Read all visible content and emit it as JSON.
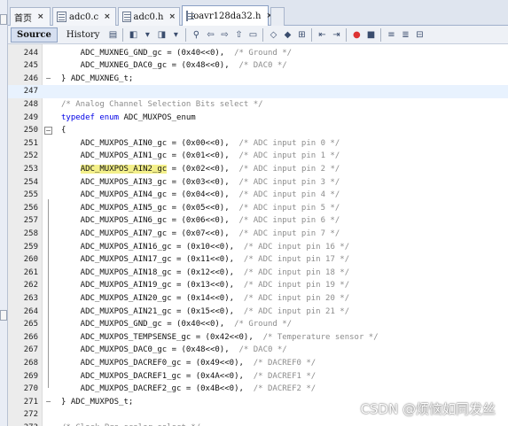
{
  "tabs": [
    {
      "label": "首页",
      "icon": "home-icon",
      "active": false
    },
    {
      "label": "adc0.c",
      "icon": "file-icon",
      "active": false
    },
    {
      "label": "adc0.h",
      "icon": "file-icon",
      "active": false
    },
    {
      "label": "ioavr128da32.h",
      "icon": "file-icon",
      "active": true
    }
  ],
  "toolbar": {
    "source_label": "Source",
    "history_label": "History"
  },
  "colors": {
    "keyword": "#0000e6",
    "comment": "#8c8c8c",
    "highlight": "#f4f08a",
    "current_line": "#e8f2fe"
  },
  "editor": {
    "lines": [
      {
        "num": "244",
        "code": "    ADC_MUXNEG_GND_gc = (0x40<<0),  ",
        "comment": "/* Ground */"
      },
      {
        "num": "245",
        "code": "    ADC_MUXNEG_DAC0_gc = (0x48<<0),  ",
        "comment": "/* DAC0 */"
      },
      {
        "num": "246",
        "code": "} ADC_MUXNEG_t;",
        "comment": ""
      },
      {
        "num": "247",
        "code": "",
        "comment": ""
      },
      {
        "num": "248",
        "code": "",
        "comment": "/* Analog Channel Selection Bits select */"
      },
      {
        "num": "249",
        "kw": "typedef enum",
        "code": " ADC_MUXPOS_enum",
        "comment": ""
      },
      {
        "num": "250",
        "code": "{",
        "comment": ""
      },
      {
        "num": "251",
        "code": "    ADC_MUXPOS_AIN0_gc = (0x00<<0),  ",
        "comment": "/* ADC input pin 0 */"
      },
      {
        "num": "252",
        "code": "    ADC_MUXPOS_AIN1_gc = (0x01<<0),  ",
        "comment": "/* ADC input pin 1 */"
      },
      {
        "num": "253",
        "pre": "    ",
        "hl": "ADC_MUXPOS_AIN2_gc",
        "code": " = (0x02<<0),  ",
        "comment": "/* ADC input pin 2 */"
      },
      {
        "num": "254",
        "code": "    ADC_MUXPOS_AIN3_gc = (0x03<<0),  ",
        "comment": "/* ADC input pin 3 */"
      },
      {
        "num": "255",
        "code": "    ADC_MUXPOS_AIN4_gc = (0x04<<0),  ",
        "comment": "/* ADC input pin 4 */"
      },
      {
        "num": "256",
        "code": "    ADC_MUXPOS_AIN5_gc = (0x05<<0),  ",
        "comment": "/* ADC input pin 5 */"
      },
      {
        "num": "257",
        "code": "    ADC_MUXPOS_AIN6_gc = (0x06<<0),  ",
        "comment": "/* ADC input pin 6 */"
      },
      {
        "num": "258",
        "code": "    ADC_MUXPOS_AIN7_gc = (0x07<<0),  ",
        "comment": "/* ADC input pin 7 */"
      },
      {
        "num": "259",
        "code": "    ADC_MUXPOS_AIN16_gc = (0x10<<0),  ",
        "comment": "/* ADC input pin 16 */"
      },
      {
        "num": "260",
        "code": "    ADC_MUXPOS_AIN17_gc = (0x11<<0),  ",
        "comment": "/* ADC input pin 17 */"
      },
      {
        "num": "261",
        "code": "    ADC_MUXPOS_AIN18_gc = (0x12<<0),  ",
        "comment": "/* ADC input pin 18 */"
      },
      {
        "num": "262",
        "code": "    ADC_MUXPOS_AIN19_gc = (0x13<<0),  ",
        "comment": "/* ADC input pin 19 */"
      },
      {
        "num": "263",
        "code": "    ADC_MUXPOS_AIN20_gc = (0x14<<0),  ",
        "comment": "/* ADC input pin 20 */"
      },
      {
        "num": "264",
        "code": "    ADC_MUXPOS_AIN21_gc = (0x15<<0),  ",
        "comment": "/* ADC input pin 21 */"
      },
      {
        "num": "265",
        "code": "    ADC_MUXPOS_GND_gc = (0x40<<0),  ",
        "comment": "/* Ground */"
      },
      {
        "num": "266",
        "code": "    ADC_MUXPOS_TEMPSENSE_gc = (0x42<<0),  ",
        "comment": "/* Temperature sensor */"
      },
      {
        "num": "267",
        "code": "    ADC_MUXPOS_DAC0_gc = (0x48<<0),  ",
        "comment": "/* DAC0 */"
      },
      {
        "num": "268",
        "code": "    ADC_MUXPOS_DACREF0_gc = (0x49<<0),  ",
        "comment": "/* DACREF0 */"
      },
      {
        "num": "269",
        "code": "    ADC_MUXPOS_DACREF1_gc = (0x4A<<0),  ",
        "comment": "/* DACREF1 */"
      },
      {
        "num": "270",
        "code": "    ADC_MUXPOS_DACREF2_gc = (0x4B<<0),  ",
        "comment": "/* DACREF2 */"
      },
      {
        "num": "271",
        "code": "} ADC_MUXPOS_t;",
        "comment": ""
      },
      {
        "num": "272",
        "code": "",
        "comment": ""
      },
      {
        "num": "273",
        "code": "",
        "comment": "/* Clock Pre-scaler select */"
      }
    ]
  },
  "watermark": "CSDN @烦恼如同发丝"
}
